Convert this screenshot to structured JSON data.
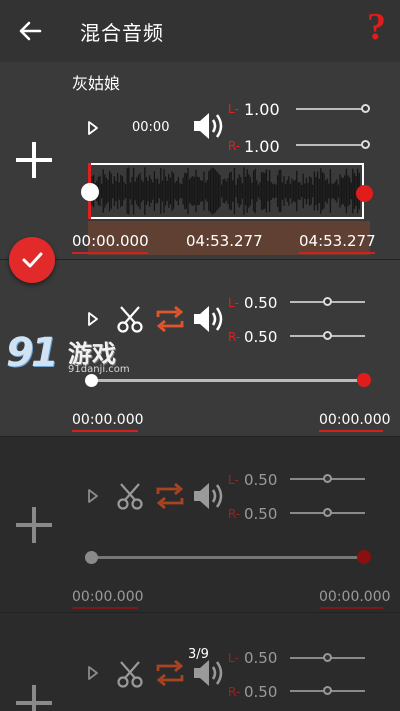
{
  "header": {
    "title": "混合音频",
    "help_symbol": "?"
  },
  "tracks": [
    {
      "name": "灰姑娘",
      "current_time": "00:00",
      "left_label": "L-",
      "right_label": "R-",
      "left_volume": "1.00",
      "right_volume": "1.00",
      "start_time": "00:00.000",
      "mid_time": "04:53.277",
      "end_time": "04:53.277"
    },
    {
      "left_label": "L-",
      "right_label": "R-",
      "left_volume": "0.50",
      "right_volume": "0.50",
      "start_time": "00:00.000",
      "end_time": "00:00.000"
    },
    {
      "left_label": "L-",
      "right_label": "R-",
      "left_volume": "0.50",
      "right_volume": "0.50",
      "start_time": "00:00.000",
      "end_time": "00:00.000"
    },
    {
      "counter": "3/9",
      "left_label": "L-",
      "right_label": "R-",
      "left_volume": "0.50",
      "right_volume": "0.50"
    }
  ],
  "watermark": {
    "number": "91",
    "text": "游戏",
    "url": "91danji.com"
  },
  "colors": {
    "accent": "#e02020",
    "loop": "#e0552a",
    "bar": "#333333",
    "panel": "#3a3a3a"
  }
}
